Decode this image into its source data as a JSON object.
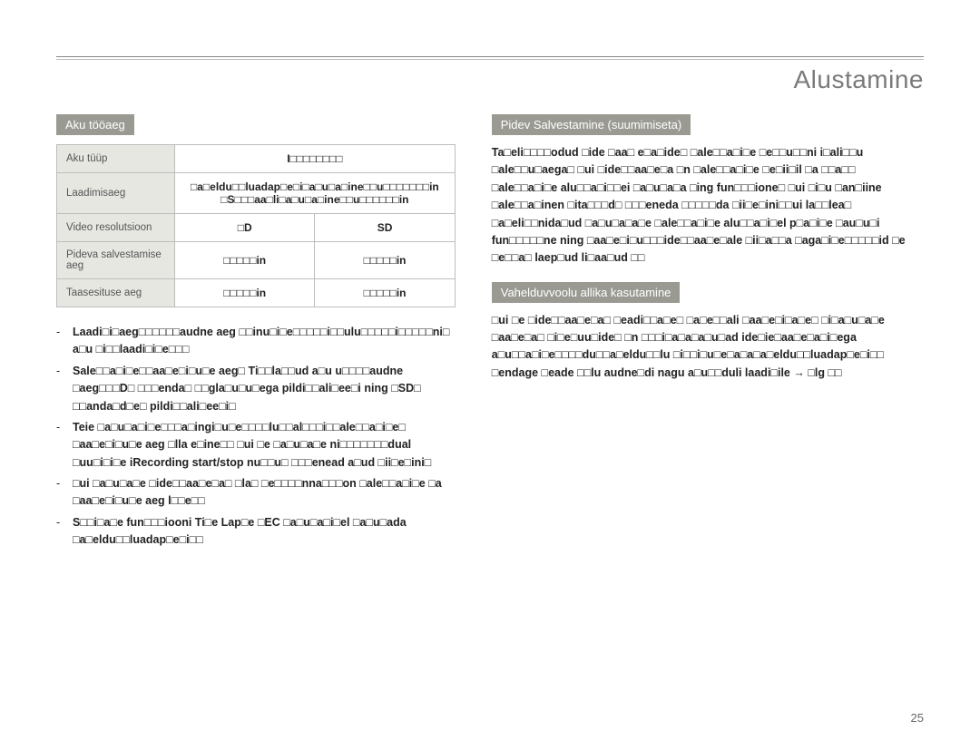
{
  "header": {
    "title": "Alustamine"
  },
  "left": {
    "label": "Aku tööaeg",
    "table": {
      "rows": [
        {
          "head": "Aku tüüp",
          "cell_full": "I□□□□□□□□"
        },
        {
          "head": "Laadimisaeg",
          "cell_full_html": "□a□eldu□□luadap□e□i□a□u□a□ine□□u□□□□□□□in\n□S□□□aa□li□a□u□a□ine□□u□□□□□□in"
        },
        {
          "head": "Video resolutsioon",
          "c1": "□D",
          "c2": "SD"
        },
        {
          "head": "Pideva salvestamise aeg",
          "c1": "□□□□□in",
          "c2": "□□□□□in"
        },
        {
          "head": "Taasesituse aeg",
          "c1": "□□□□□in",
          "c2": "□□□□□in"
        }
      ]
    },
    "bullets": [
      "Laadi□i□aeg□□□□□□audne aeg □□inu□i□e□□□□□i□□ulu□□□□□i□□□□□ni□ a□u □i□□laadi□i□e□□□",
      "Sale□□a□i□e□□aa□e□i□u□e aeg□ Ti□□la□□ud a□u u□□□□audne □aeg□□□D□ □□□enda□ □□gla□u□u□ega pildi□□ali□ee□i ning □SD□ □□anda□d□e□ pildi□□ali□ee□i□",
      "Teie □a□u□a□i□e□□□a□ingi□u□e□□□□lu□□al□□□i□□ale□□a□i□e□ □aa□e□i□u□e aeg □lla e□ine□□ □ui □e □a□u□a□e ni□□□□□□□dual □uu□i□i□e iRecording start/stop nu□□u□ □□□enead a□ud □ii□e□ini□",
      "□ui □a□u□a□e □ide□□aa□e□a□ □la□ □e□□□□nna□□□on □ale□□a□i□e □a □aa□e□i□u□e aeg l□□e□□",
      "S□□i□a□e fun□□□iooni Ti□e Lap□e □EC □a□u□a□i□el □a□u□ada □a□eldu□□luadap□e□i□□"
    ]
  },
  "right": {
    "section1": {
      "label": "Pidev Salvestamine (suumimiseta)",
      "text": "Ta□eli□□□□odud □ide □aa□ e□a□ide□ □ale□□a□i□e □e□□u□□ni i□ali□□u □ale□□u□aega□ □ui □ide□□aa□e□a □n □ale□□a□i□e □e□ii□il □a □□a□□ □ale□□a□i□e alu□□a□i□□ei □a□u□a□a □ing fun□□□ione□ □ui □i□u □an□iine □ale□□a□inen □ita□□□d□ □□□eneda □□□□□da □ii□e□ini□□ui la□□lea□ □a□eli□□nida□ud □a□u□a□a□e □ale□□a□i□e alu□□a□i□el p□a□i□e □au□u□i fun□□□□□ne ning □aa□e□i□u□□□ide□□aa□e□ale □ii□a□□a □aga□i□e□□□□□id □e □e□□a□ laep□ud li□aa□ud □□"
    },
    "section2": {
      "label": "Vahelduvvoolu allika kasutamine",
      "text": "□ui □e □ide□□aa□e□a□ □eadi□□a□e□ □a□e□□ali □aa□e□i□a□e□ □i□a□u□a□e □aa□e□a□ □i□e□uu□ide□ □n □□□i□a□a□a□u□ad ide□ie□aa□e□a□i□ega a□u□□a□i□e□□□□du□□a□eldu□□lu □i□□i□u□e□a□a□a□eldu□□luadap□e□i□□ □endage □eade □□lu audne□di nagu a□u□□duli laadi□ile → □lg □□"
    }
  },
  "page": "25"
}
